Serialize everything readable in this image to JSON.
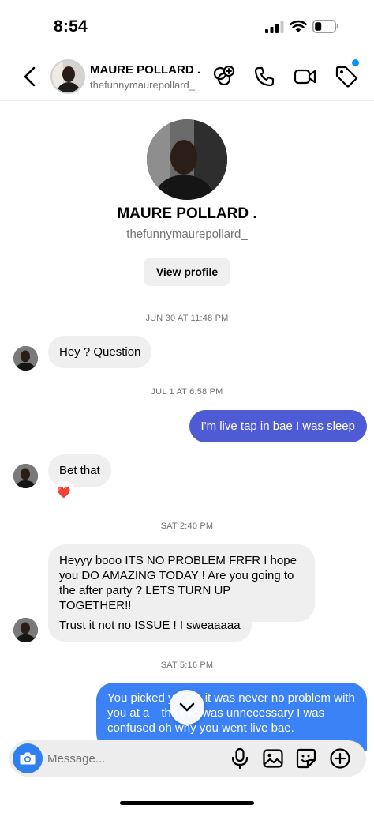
{
  "status_bar": {
    "time": "8:54"
  },
  "header": {
    "name": "MAURE POLLARD .",
    "username": "thefunnymaurepollard_",
    "icons": [
      "back-chevron-icon",
      "add-people-icon",
      "phone-icon",
      "video-camera-icon",
      "tag-icon"
    ]
  },
  "profile": {
    "name": "MAURE POLLARD .",
    "username": "thefunnymaurepollard_",
    "view_profile_label": "View profile"
  },
  "conversation": {
    "timestamps": [
      "JUN 30 AT 11:48 PM",
      "JUL 1 AT 6:58 PM",
      "SAT 2:40 PM",
      "SAT 5:16 PM"
    ],
    "messages": [
      {
        "from": "them",
        "text": "Hey ? Question"
      },
      {
        "from": "me",
        "text": "I'm live tap in bae I was sleep"
      },
      {
        "from": "them",
        "text": "Bet that",
        "reaction": "❤️"
      },
      {
        "from": "them",
        "text": "Heyyy booo ITS NO PROBLEM FRFR I hope you DO AMAZING TODAY ! Are you going to the after party ? LETS TURN UP TOGETHER!!"
      },
      {
        "from": "them",
        "text": "Trust it not no ISSUE ! I sweaaaaa"
      },
      {
        "from": "me",
        "text": "You picked y     ide it was never no problem with you at a     the live was unnecessary I was confused oh why you went live bae."
      }
    ]
  },
  "composer": {
    "placeholder": "Message...",
    "value": "",
    "icons": [
      "camera-icon",
      "microphone-icon",
      "gallery-icon",
      "sticker-icon",
      "plus-icon"
    ]
  },
  "colors": {
    "outgoing_bubble": "#4f5bd5",
    "outgoing_bubble_latest": "#3b82f6",
    "incoming_bubble": "#efefef",
    "camera_button": "#2f7ff0",
    "notification_dot": "#0095f6"
  }
}
